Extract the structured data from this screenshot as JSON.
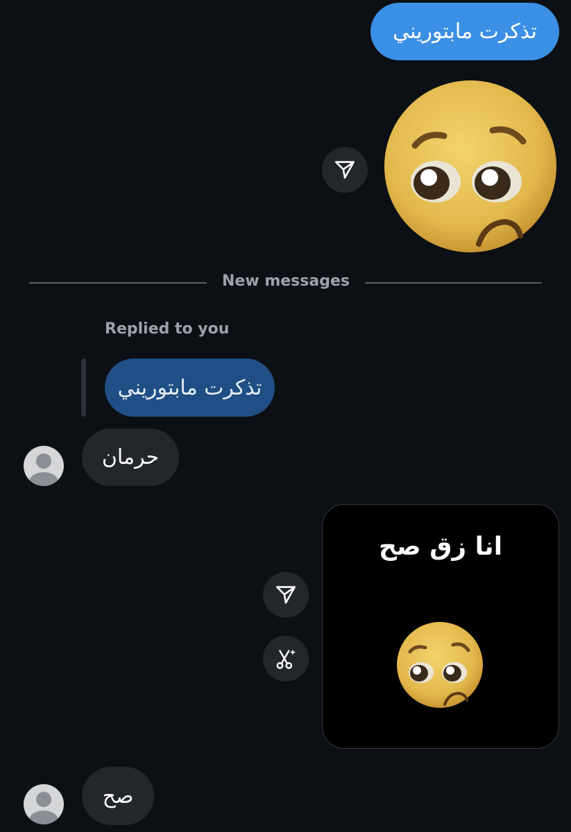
{
  "messages": {
    "sent_text": "تذكرت مابتوريني",
    "new_messages_divider": "New messages",
    "replied_label": "Replied to you",
    "replied_quote": "تذكرت مابتوريني",
    "received_1": "حرمان",
    "media_caption": "انا زق صح",
    "received_2": "صح"
  },
  "icons": {
    "share": "paper-plane-icon",
    "remix": "scissors-sparkle-icon",
    "avatar": "default-user-icon",
    "sticker": "pleading-face-emoji"
  },
  "colors": {
    "background": "#0c1015",
    "sent_bubble": "#3b8fe4",
    "replied_bubble": "#1f4f84",
    "received_bubble": "#23262b",
    "muted_text": "#9ca2ab"
  }
}
